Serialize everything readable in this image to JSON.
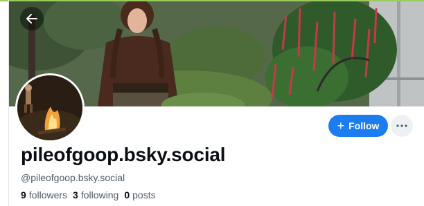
{
  "profile": {
    "display_name": "pileofgoop.bsky.social",
    "handle": "@pileofgoop.bsky.social",
    "stats": {
      "followers_count": "9",
      "followers_label": "followers",
      "following_count": "3",
      "following_label": "following",
      "posts_count": "0",
      "posts_label": "posts"
    }
  },
  "actions": {
    "follow_label": "Follow",
    "follow_icon": "plus-icon",
    "more_icon": "ellipsis-icon",
    "back_icon": "arrow-left-icon"
  },
  "colors": {
    "accent": "#1c7df0",
    "top_accent": "#9acb5e"
  }
}
